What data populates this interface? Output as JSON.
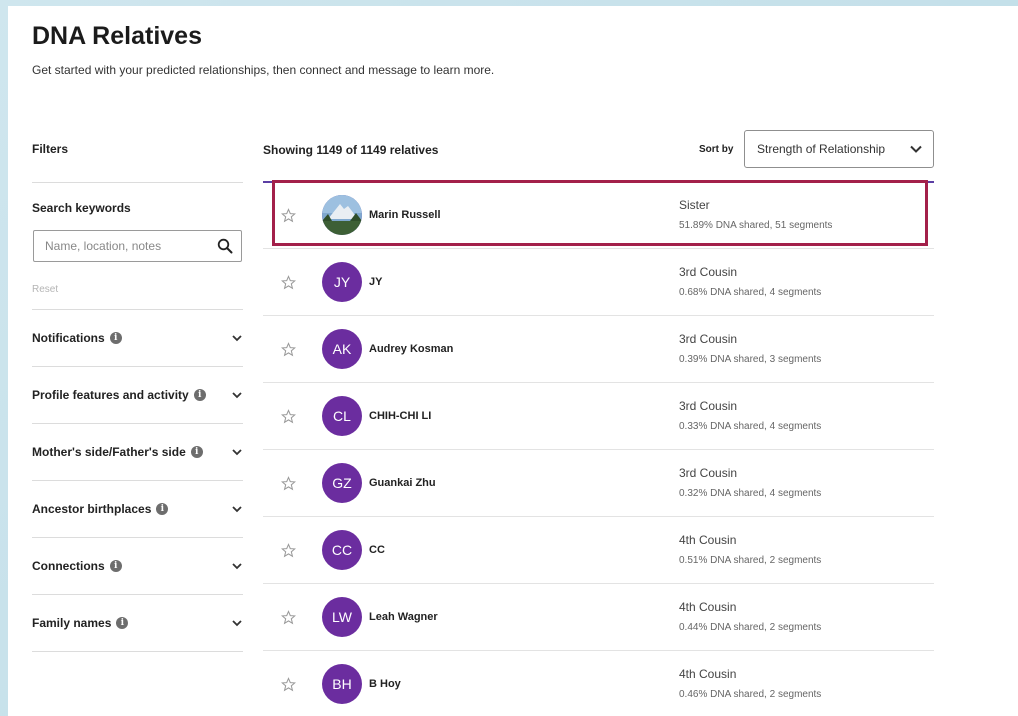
{
  "header": {
    "title": "DNA Relatives",
    "subtitle": "Get started with your predicted relationships, then connect and message to learn more."
  },
  "sidebar": {
    "filters_label": "Filters",
    "search_label": "Search keywords",
    "search_placeholder": "Name, location, notes",
    "reset_label": "Reset",
    "filters": [
      {
        "label": "Notifications"
      },
      {
        "label": "Profile features and activity"
      },
      {
        "label": "Mother's side/Father's side"
      },
      {
        "label": "Ancestor birthplaces"
      },
      {
        "label": "Connections"
      },
      {
        "label": "Family names"
      }
    ]
  },
  "list": {
    "showing_text": "Showing 1149 of 1149 relatives",
    "sort_label": "Sort by",
    "sort_value": "Strength of Relationship",
    "relatives": [
      {
        "initials": "",
        "name": "Marin Russell",
        "relationship": "Sister",
        "dna": "51.89% DNA shared, 51 segments"
      },
      {
        "initials": "JY",
        "name": "JY",
        "relationship": "3rd Cousin",
        "dna": "0.68% DNA shared, 4 segments"
      },
      {
        "initials": "AK",
        "name": "Audrey Kosman",
        "relationship": "3rd Cousin",
        "dna": "0.39% DNA shared, 3 segments"
      },
      {
        "initials": "CL",
        "name": "CHIH-CHI LI",
        "relationship": "3rd Cousin",
        "dna": "0.33% DNA shared, 4 segments"
      },
      {
        "initials": "GZ",
        "name": "Guankai Zhu",
        "relationship": "3rd Cousin",
        "dna": "0.32% DNA shared, 4 segments"
      },
      {
        "initials": "CC",
        "name": "CC",
        "relationship": "4th Cousin",
        "dna": "0.51% DNA shared, 2 segments"
      },
      {
        "initials": "LW",
        "name": "Leah Wagner",
        "relationship": "4th Cousin",
        "dna": "0.44% DNA shared, 2 segments"
      },
      {
        "initials": "BH",
        "name": "B Hoy",
        "relationship": "4th Cousin",
        "dna": "0.46% DNA shared, 2 segments"
      }
    ]
  },
  "colors": {
    "accent": "#5b3ea4",
    "avatar": "#6b2d9f",
    "highlight": "#a3204a"
  }
}
